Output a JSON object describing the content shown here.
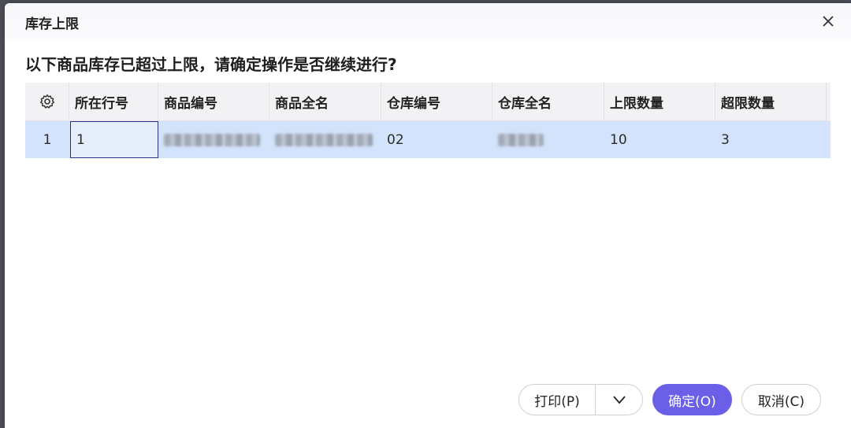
{
  "dialog": {
    "title": "库存上限",
    "message": "以下商品库存已超过上限，请确定操作是否继续进行?"
  },
  "grid": {
    "settings_icon": "gear-icon",
    "columns": [
      "所在行号",
      "商品编号",
      "商品全名",
      "仓库编号",
      "仓库全名",
      "上限数量",
      "超限数量"
    ],
    "rows": [
      {
        "index": "1",
        "line_no": "1",
        "product_code": "",
        "product_name": "",
        "warehouse_code": "02",
        "warehouse_name": "",
        "limit_qty": "10",
        "over_qty": "3"
      }
    ]
  },
  "buttons": {
    "print": "打印(P)",
    "ok": "确定(O)",
    "cancel": "取消(C)"
  },
  "colors": {
    "accent": "#6a5fe6",
    "selected_row": "#d2e3fb",
    "header_bg": "#f2f2f4"
  }
}
